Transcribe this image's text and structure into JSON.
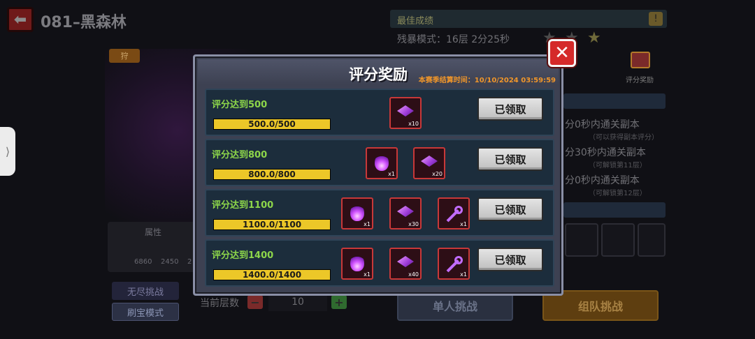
{
  "background": {
    "stage_title": "081–黑森林",
    "side_pull_glyph": "⟩",
    "tag_text": "狩",
    "attributes": {
      "title": "属性",
      "values": [
        "6860",
        "2450",
        "2"
      ]
    },
    "modes": [
      "无尽挑战",
      "刷宝模式"
    ],
    "floor": {
      "label": "当前层数",
      "value": "10",
      "minus": "−",
      "plus": "+"
    },
    "best": {
      "title": "最佳成绩",
      "info_glyph": "!",
      "mode_text": "残暴模式：16层 2分25秒",
      "stars_filled": 1,
      "stars_total": 3
    },
    "reward_button_label": "评分奖励",
    "conditions": [
      {
        "main": "分0秒内通关副本",
        "sub": "（可以获得副本评分）"
      },
      {
        "main": "分30秒内通关副本",
        "sub": "（可解锁第11层）"
      },
      {
        "main": "分0秒内通关副本",
        "sub": "（可解锁第12层）"
      }
    ],
    "buttons": {
      "solo": "单人挑战",
      "team": "组队挑战"
    }
  },
  "modal": {
    "title": "评分奖励",
    "season_end": "本赛季结算时间：10/10/2024 03:59:59",
    "close_glyph": "✕",
    "rows": [
      {
        "label": "评分达到500",
        "progress_text": "500.0/500",
        "progress": 1.0,
        "items": [
          {
            "type": "gem-icon",
            "qty": "x10"
          }
        ],
        "button": "已领取"
      },
      {
        "label": "评分达到800",
        "progress_text": "800.0/800",
        "progress": 1.0,
        "items": [
          {
            "type": "flame-icon",
            "qty": "x1"
          },
          {
            "type": "gem-icon",
            "qty": "x20"
          }
        ],
        "button": "已领取"
      },
      {
        "label": "评分达到1100",
        "progress_text": "1100.0/1100",
        "progress": 1.0,
        "items": [
          {
            "type": "flame-icon",
            "qty": "x1"
          },
          {
            "type": "gem-icon",
            "qty": "x30"
          },
          {
            "type": "key-icon",
            "qty": "x1"
          }
        ],
        "button": "已领取"
      },
      {
        "label": "评分达到1400",
        "progress_text": "1400.0/1400",
        "progress": 1.0,
        "items": [
          {
            "type": "flame-icon",
            "qty": "x1"
          },
          {
            "type": "gem-icon",
            "qty": "x40"
          },
          {
            "type": "key-icon",
            "qty": "x1"
          }
        ],
        "button": "已领取"
      }
    ]
  }
}
